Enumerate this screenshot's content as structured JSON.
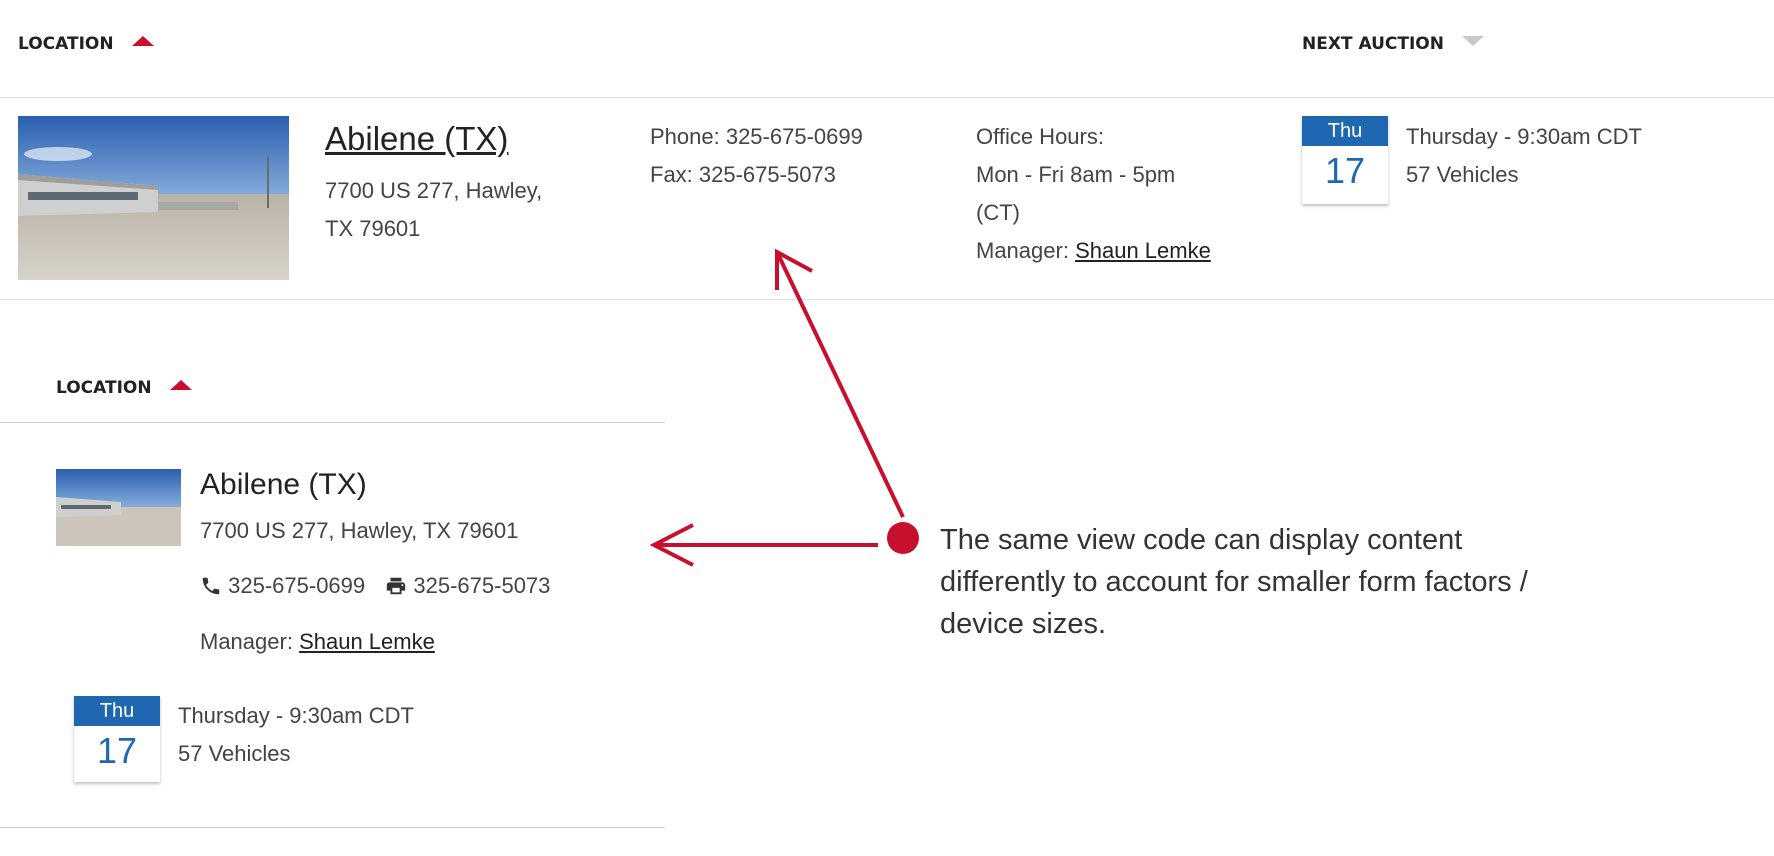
{
  "desktop": {
    "header": {
      "location_label": "LOCATION",
      "next_auction_label": "NEXT AUCTION"
    },
    "row": {
      "name": "Abilene (TX)",
      "address_line1": "7700 US 277, Hawley,",
      "address_line2": "TX 79601",
      "phone": "Phone: 325-675-0699",
      "fax": "Fax: 325-675-5073",
      "office_hours_label": "Office Hours:",
      "office_hours_line1": "Mon - Fri 8am - 5pm",
      "office_hours_line2": "(CT)",
      "manager_label": "Manager: ",
      "manager_name": "Shaun Lemke",
      "auction": {
        "day_abbr": "Thu",
        "day_num": "17",
        "time": "Thursday - 9:30am CDT",
        "vehicles": "57 Vehicles"
      }
    }
  },
  "mobile": {
    "header": {
      "location_label": "LOCATION"
    },
    "row": {
      "name": "Abilene (TX)",
      "address": "7700 US 277, Hawley, TX 79601",
      "phone": "325-675-0699",
      "fax": "325-675-5073",
      "manager_label": "Manager: ",
      "manager_name": "Shaun Lemke",
      "auction": {
        "day_abbr": "Thu",
        "day_num": "17",
        "time": "Thursday - 9:30am CDT",
        "vehicles": "57 Vehicles"
      }
    }
  },
  "annotation": {
    "line1": "The same view code can display content",
    "line2": "differently to account for smaller form factors /",
    "line3": "device sizes."
  },
  "colors": {
    "accent_red": "#c8102e",
    "calendar_blue": "#1f67b1",
    "divider": "#e0e0e0"
  },
  "icons": {
    "phone": "phone-icon",
    "fax": "fax-icon",
    "sort_asc": "caret-up-icon",
    "sort_none": "caret-down-icon"
  }
}
